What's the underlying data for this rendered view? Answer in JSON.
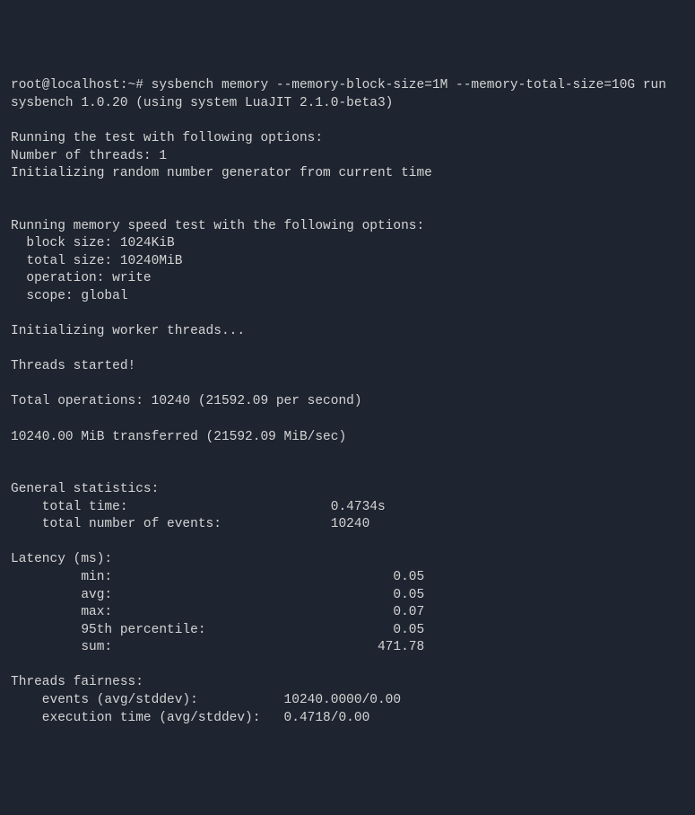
{
  "prompt": "root@localhost:~# ",
  "command": "sysbench memory --memory-block-size=1M --memory-total-size=10G run",
  "version_line": "sysbench 1.0.20 (using system LuaJIT 2.1.0-beta3)",
  "options_header": "Running the test with following options:",
  "threads_line": "Number of threads: 1",
  "rng_line": "Initializing random number generator from current time",
  "memtest_header": "Running memory speed test with the following options:",
  "block_size": "  block size: 1024KiB",
  "total_size": "  total size: 10240MiB",
  "operation": "  operation: write",
  "scope": "  scope: global",
  "init_workers": "Initializing worker threads...",
  "threads_started": "Threads started!",
  "total_ops": "Total operations: 10240 (21592.09 per second)",
  "transferred": "10240.00 MiB transferred (21592.09 MiB/sec)",
  "stats_header": "General statistics:",
  "total_time": "    total time:                          0.4734s",
  "total_events": "    total number of events:              10240",
  "latency_header": "Latency (ms):",
  "lat_min": "         min:                                    0.05",
  "lat_avg": "         avg:                                    0.05",
  "lat_max": "         max:                                    0.07",
  "lat_p95": "         95th percentile:                        0.05",
  "lat_sum": "         sum:                                  471.78",
  "fairness_header": "Threads fairness:",
  "fair_events": "    events (avg/stddev):           10240.0000/0.00",
  "fair_exec": "    execution time (avg/stddev):   0.4718/0.00"
}
